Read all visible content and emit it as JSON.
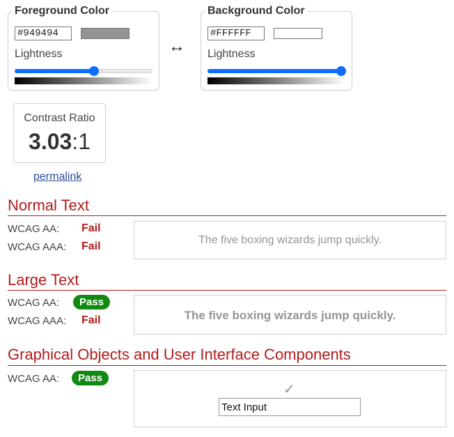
{
  "foreground": {
    "title": "Foreground Color",
    "hex": "#949494",
    "lightness_label": "Lightness",
    "lightness": 0.58,
    "swatch_color": "#949494"
  },
  "background": {
    "title": "Background Color",
    "hex": "#FFFFFF",
    "lightness_label": "Lightness",
    "lightness": 1.0,
    "swatch_color": "#FFFFFF"
  },
  "swap_icon": "↔",
  "contrast": {
    "title": "Contrast Ratio",
    "value": "3.03",
    "suffix": ":1"
  },
  "permalink": "permalink",
  "normal_text": {
    "heading": "Normal Text",
    "aa_label": "WCAG AA:",
    "aa_result": "Fail",
    "aaa_label": "WCAG AAA:",
    "aaa_result": "Fail",
    "sample": "The five boxing wizards jump quickly."
  },
  "large_text": {
    "heading": "Large Text",
    "aa_label": "WCAG AA:",
    "aa_result": "Pass",
    "aaa_label": "WCAG AAA:",
    "aaa_result": "Fail",
    "sample": "The five boxing wizards jump quickly."
  },
  "graphical": {
    "heading": "Graphical Objects and User Interface Components",
    "aa_label": "WCAG AA:",
    "aa_result": "Pass",
    "check_icon": "✓",
    "input_value": "Text Input"
  },
  "colors": {
    "accent": "#0d6efd",
    "fail": "#b31b1b",
    "pass": "#118a11"
  }
}
